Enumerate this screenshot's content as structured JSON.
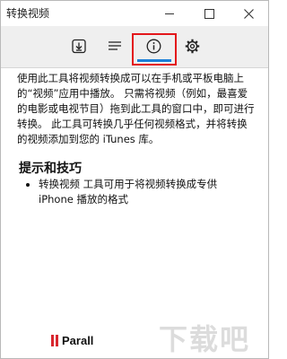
{
  "window": {
    "title": "转换视频"
  },
  "toolbar": {
    "items": [
      {
        "name": "download",
        "icon": "download-icon"
      },
      {
        "name": "list",
        "icon": "menu-lines-icon"
      },
      {
        "name": "info",
        "icon": "info-circle-icon",
        "selected": true
      },
      {
        "name": "settings",
        "icon": "gear-icon"
      }
    ],
    "selected_highlight_color": "#e3161b",
    "selected_underline_color": "#1b7fd8"
  },
  "content": {
    "intro": "使用此工具将视频转换成可以在手机或平板电脑上的“视频”应用中播放。 只需将视频（例如，最喜爱的电影或电视节目）拖到此工具的窗口中，即可进行转换。 此工具可转换几乎任何视频格式，并将转换的视频添加到您的 iTunes 库。",
    "tips_heading": "提示和技巧",
    "tips": [
      "转换视频 工具可用于将视频转换成专供 iPhone 播放的格式"
    ]
  },
  "footer": {
    "brand": "Parall",
    "brand_color": "#d8262e"
  },
  "watermark": {
    "text": "下载吧"
  }
}
